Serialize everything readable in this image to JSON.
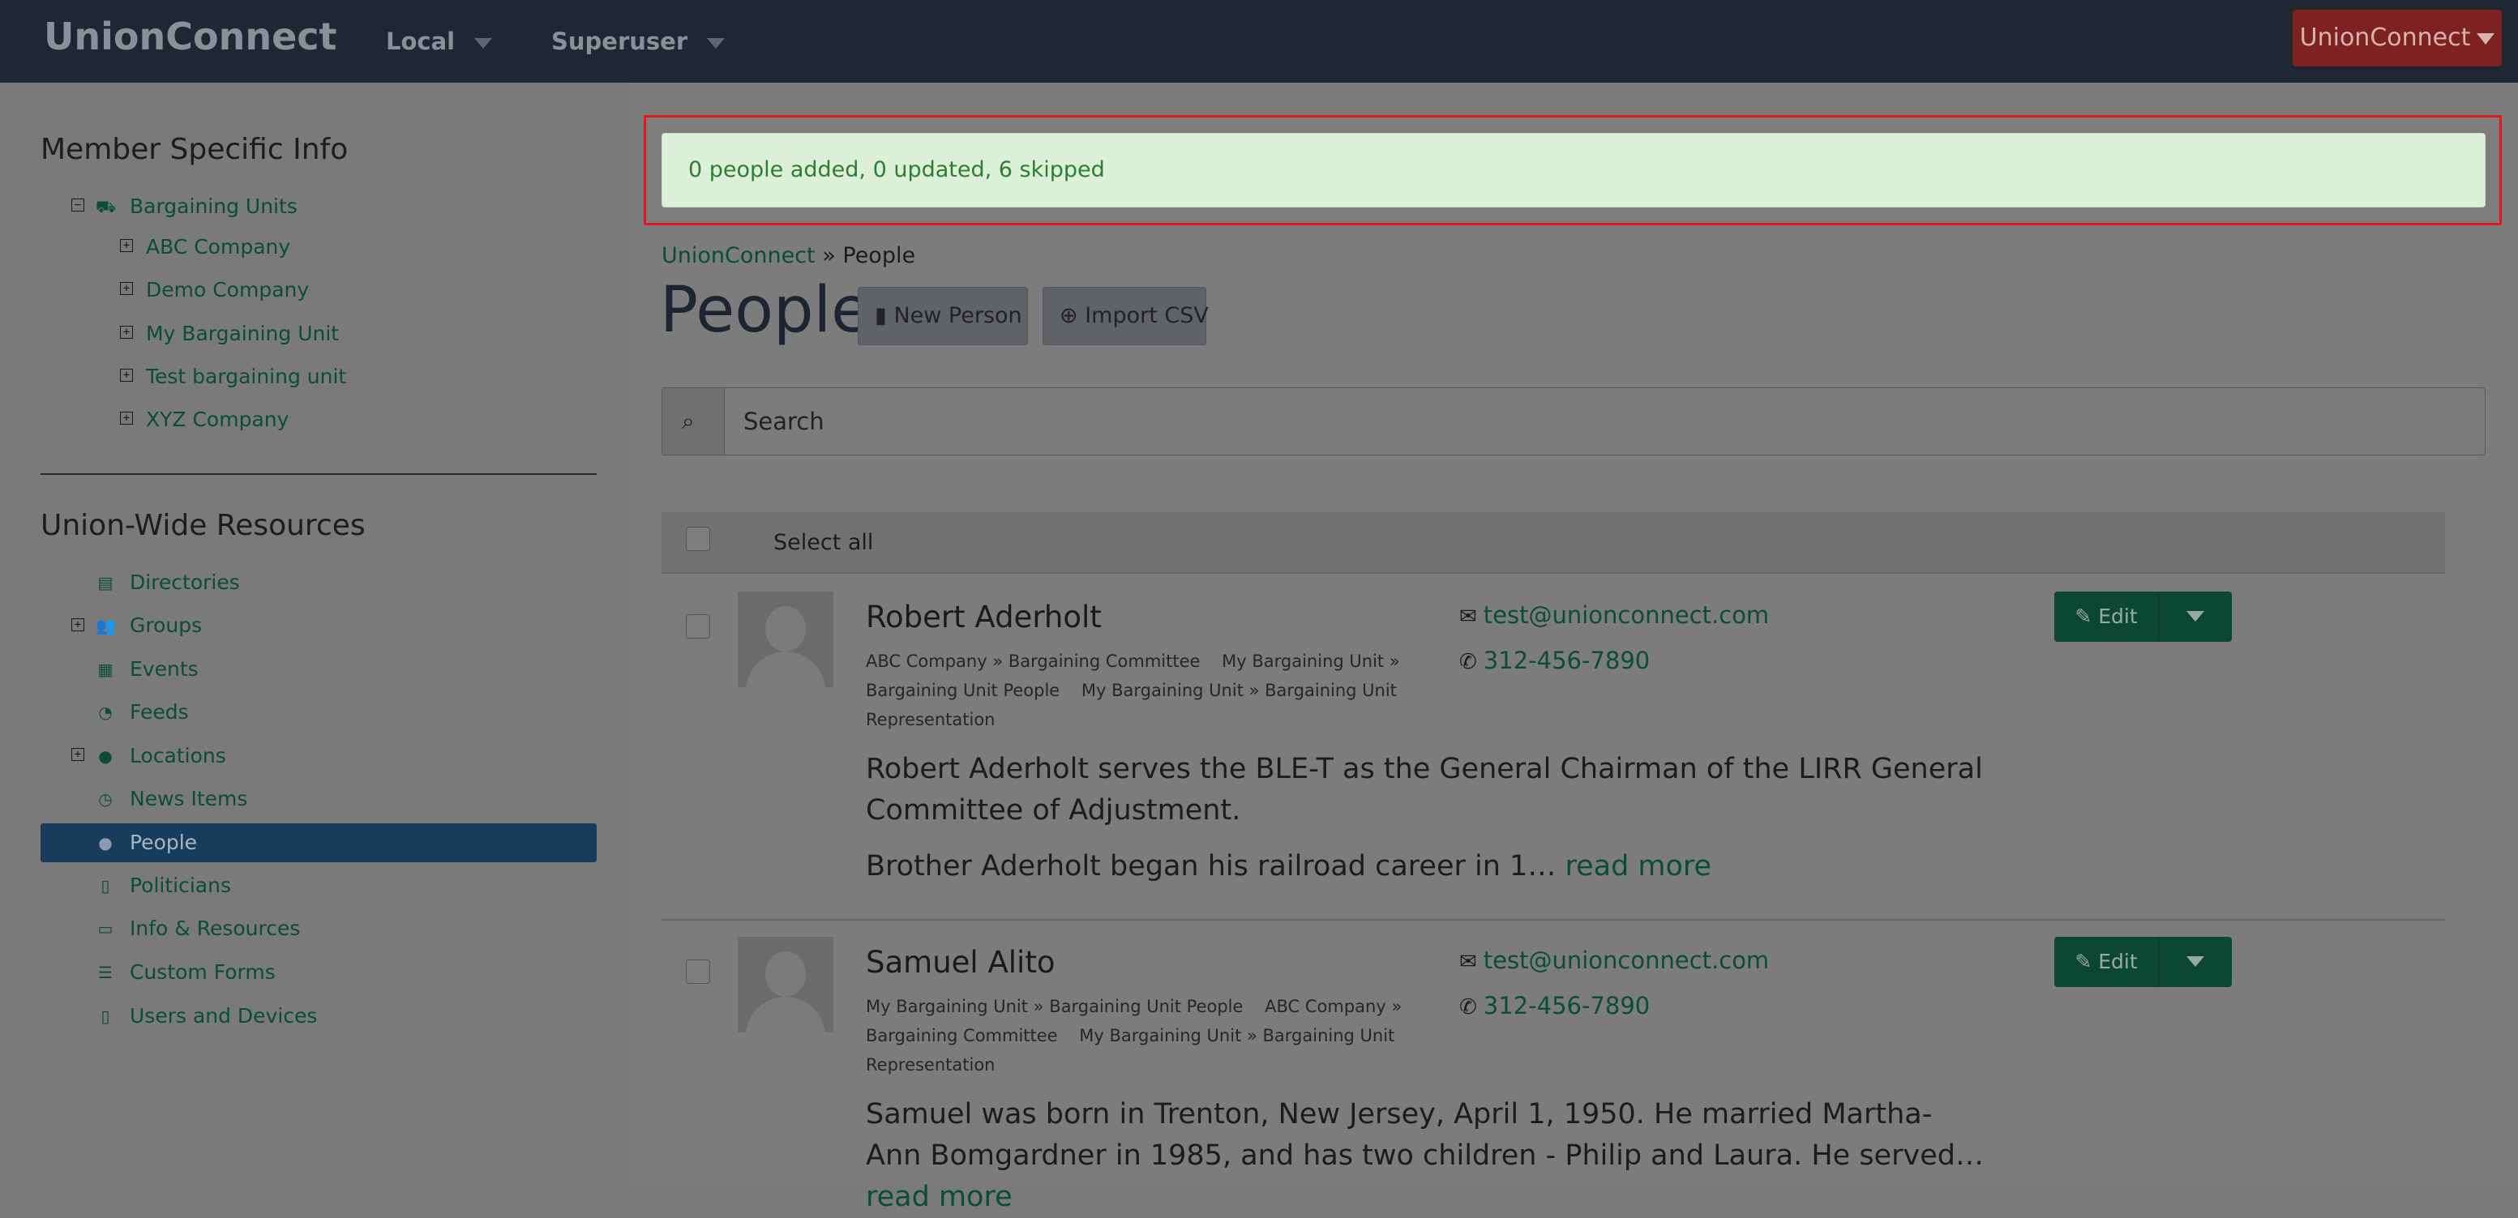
{
  "navbar": {
    "brand": "UnionConnect",
    "local_label": "Local",
    "superuser_label": "Superuser",
    "account_button": "UnionConnect"
  },
  "sidebar": {
    "member_heading": "Member Specific Info",
    "bargaining_units": {
      "label": "Bargaining Units",
      "children": [
        "ABC Company",
        "Demo Company",
        "My Bargaining Unit",
        "Test bargaining unit",
        "XYZ Company"
      ]
    },
    "resources_heading": "Union-Wide Resources",
    "resources": [
      {
        "label": "Directories",
        "icon": "book-icon"
      },
      {
        "label": "Groups",
        "icon": "users-icon"
      },
      {
        "label": "Events",
        "icon": "calendar-icon"
      },
      {
        "label": "Feeds",
        "icon": "rss-icon"
      },
      {
        "label": "Locations",
        "icon": "globe-icon"
      },
      {
        "label": "News Items",
        "icon": "clock-icon"
      },
      {
        "label": "People",
        "icon": "user-icon",
        "active": true
      },
      {
        "label": "Politicians",
        "icon": "building-icon"
      },
      {
        "label": "Info & Resources",
        "icon": "folder-icon"
      },
      {
        "label": "Custom Forms",
        "icon": "list-icon"
      },
      {
        "label": "Users and Devices",
        "icon": "tablet-icon"
      }
    ]
  },
  "alert": {
    "message": "0 people added, 0 updated, 6 skipped"
  },
  "breadcrumb": {
    "root": "UnionConnect",
    "separator": "»",
    "current": "People"
  },
  "page": {
    "title": "People",
    "new_person_button": "New Person",
    "import_csv_button": "Import CSV"
  },
  "search": {
    "placeholder": "Search"
  },
  "list": {
    "select_all_label": "Select all"
  },
  "people": [
    {
      "name": "Robert Aderholt",
      "tags": [
        "ABC Company » Bargaining Committee",
        "My Bargaining Unit » Bargaining Unit People",
        "My Bargaining Unit » Bargaining Unit Representation"
      ],
      "email": "test@unionconnect.com",
      "phone": "312-456-7890",
      "bio_p1": "Robert Aderholt serves the BLE-T as the General Chairman of the LIRR General Committee of Adjustment.",
      "bio_p2": "Brother Aderholt began his railroad career in 1…",
      "read_more": "read more",
      "edit_label": "Edit"
    },
    {
      "name": "Samuel Alito",
      "tags": [
        "My Bargaining Unit » Bargaining Unit People",
        "ABC Company » Bargaining Committee",
        "My Bargaining Unit » Bargaining Unit Representation"
      ],
      "email": "test@unionconnect.com",
      "phone": "312-456-7890",
      "bio_p1": "Samuel was born in Trenton, New Jersey, April 1, 1950. He married Martha-Ann Bomgardner in 1985, and has two children - Philip and Laura. He served…",
      "read_more": "read more",
      "edit_label": "Edit"
    }
  ]
}
